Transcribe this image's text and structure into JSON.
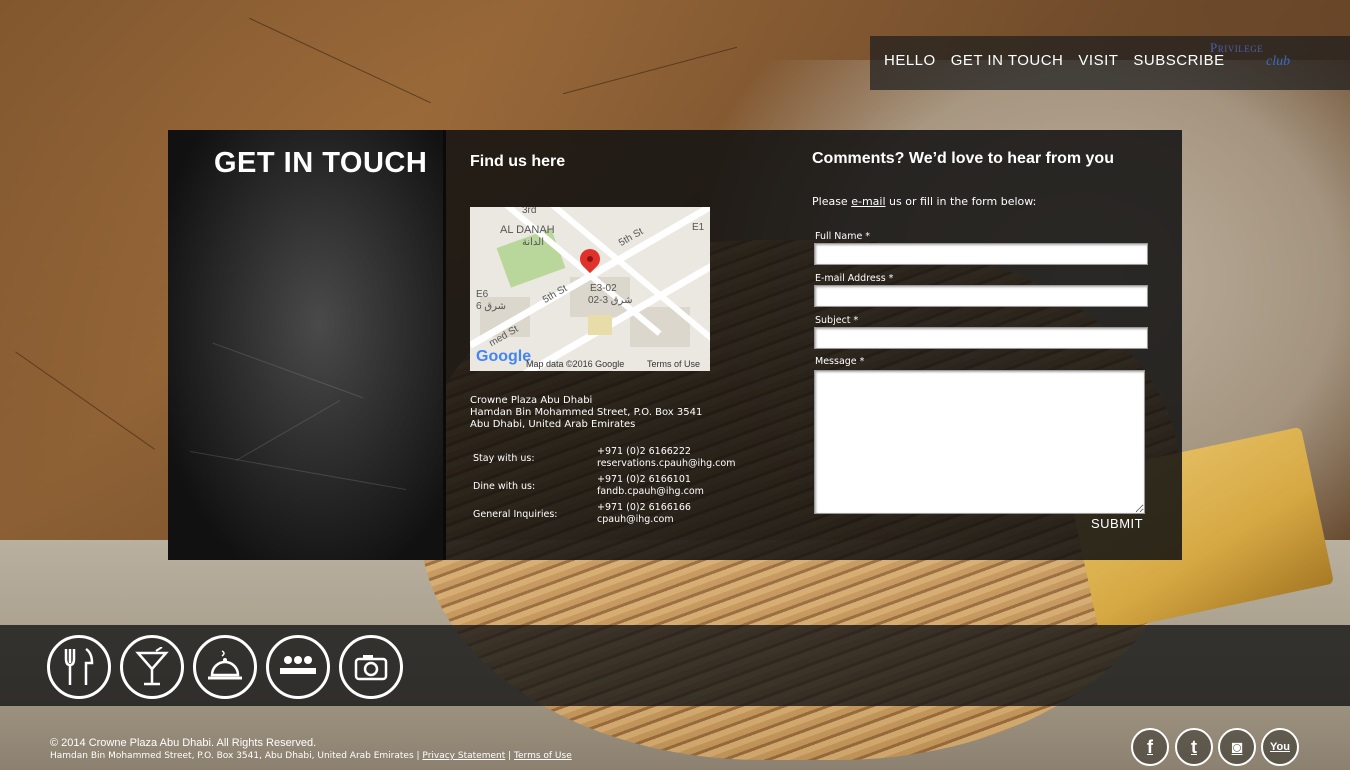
{
  "nav": {
    "items": [
      "HELLO",
      "GET IN TOUCH",
      "VISIT",
      "SUBSCRIBE"
    ],
    "logo_line1": "Privilege",
    "logo_line2": "club"
  },
  "page": {
    "title": "GET IN TOUCH",
    "find_title": "Find us here"
  },
  "map": {
    "labels": [
      "3rd",
      "AL DANAH",
      "الدانة",
      "5th St",
      "E1",
      "5th St",
      "E3-02",
      "02-3 شرق",
      "E6",
      "شرق 6",
      "med St"
    ],
    "google": "Google",
    "map_data": "Map data ©2016 Google",
    "terms": "Terms of Use"
  },
  "address": {
    "line1": "Crowne Plaza Abu Dhabi",
    "line2": "Hamdan Bin Mohammed Street, P.O. Box 3541",
    "line3": "Abu Dhabi, United Arab Emirates"
  },
  "contacts": [
    {
      "label": "Stay with us:",
      "phone": "+971 (0)2 6166222",
      "email": "reservations.cpauh@ihg.com"
    },
    {
      "label": "Dine with us:",
      "phone": "+971 (0)2 6166101",
      "email": "fandb.cpauh@ihg.com"
    },
    {
      "label": "General Inquiries:",
      "phone": "+971 (0)2 6166166",
      "email": "cpauh@ihg.com"
    }
  ],
  "form": {
    "title": "Comments? We’d love to hear from you",
    "intro_before": "Please ",
    "intro_link": "e-mail",
    "intro_after": " us or fill in the form below:",
    "full_name_label": "Full Name *",
    "email_label": "E-mail Address *",
    "subject_label": "Subject *",
    "message_label": "Message *",
    "full_name_value": "",
    "email_value": "",
    "subject_value": "",
    "message_value": "",
    "submit": "SUBMIT"
  },
  "category_icons": [
    "dining-icon",
    "cocktail-icon",
    "room-service-icon",
    "meetings-icon",
    "gallery-camera-icon"
  ],
  "footer": {
    "copyright": "© 2014 Crowne Plaza Abu Dhabi. All Rights Reserved.",
    "address": "Hamdan Bin Mohammed Street, P.O. Box 3541, Abu Dhabi, United Arab Emirates |",
    "privacy": "Privacy Statement",
    "separator": "|",
    "terms": "Terms of Use"
  },
  "social": [
    {
      "name": "facebook-icon",
      "glyph": "f"
    },
    {
      "name": "twitter-icon",
      "glyph": "t"
    },
    {
      "name": "instagram-icon",
      "glyph": "◙"
    },
    {
      "name": "youtube-icon",
      "glyph": "You"
    }
  ],
  "colors": {
    "panel": "#121212",
    "text": "#ffffff",
    "map_pin": "#e0322a"
  }
}
